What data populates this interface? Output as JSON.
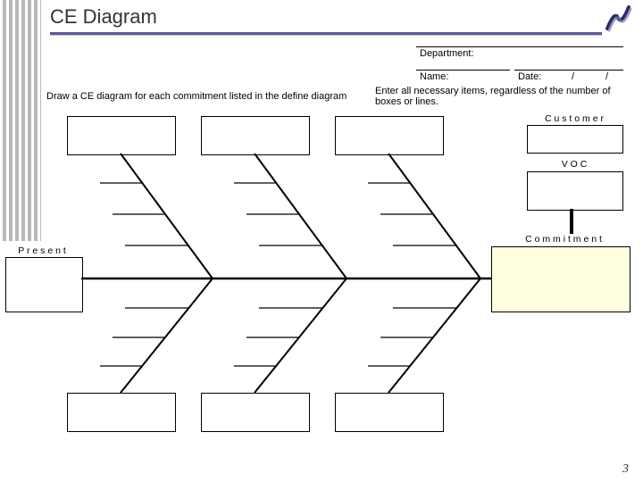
{
  "title": "CE Diagram",
  "header": {
    "department_label": "Department:",
    "name_label": "Name:",
    "date_label": "Date:",
    "date_sep": "/"
  },
  "instructions": {
    "left": "Draw a CE diagram for each commitment listed in the define diagram",
    "right": "Enter all necessary items, regardless of the number of boxes or lines."
  },
  "labels": {
    "customer": "C u s t o m e r",
    "voc": "V  O  C",
    "commitment": "C o m m i t m e n t",
    "present": "P r e s e n t"
  },
  "page_number": "3"
}
